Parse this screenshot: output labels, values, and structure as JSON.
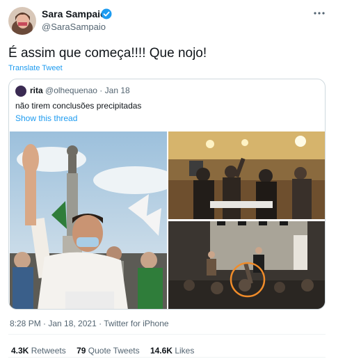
{
  "author": {
    "name": "Sara Sampaio",
    "handle": "@SaraSampaio"
  },
  "tweet": {
    "text": "É assim que começa!!!! Que nojo!",
    "translate_label": "Translate Tweet"
  },
  "quote": {
    "name": "rita",
    "handle": "@olhequenao",
    "separator": "·",
    "date": "Jan 18",
    "text": "não tirem conclusões precipitadas",
    "show_thread": "Show this thread"
  },
  "timestamp": {
    "time": "8:28 PM",
    "date": "Jan 18, 2021",
    "source": "Twitter for iPhone",
    "full": "8:28 PM · Jan 18, 2021 · Twitter for iPhone"
  },
  "stats": {
    "retweets_count": "4.3K",
    "retweets_label": "Retweets",
    "quotes_count": "79",
    "quotes_label": "Quote Tweets",
    "likes_count": "14.6K",
    "likes_label": "Likes"
  },
  "colors": {
    "accent": "#1d9bf0",
    "text": "#0f1419",
    "muted": "#536471",
    "border": "#cfd9de"
  },
  "icons": {
    "verified": "verified-badge-icon",
    "more": "more-options-icon"
  }
}
